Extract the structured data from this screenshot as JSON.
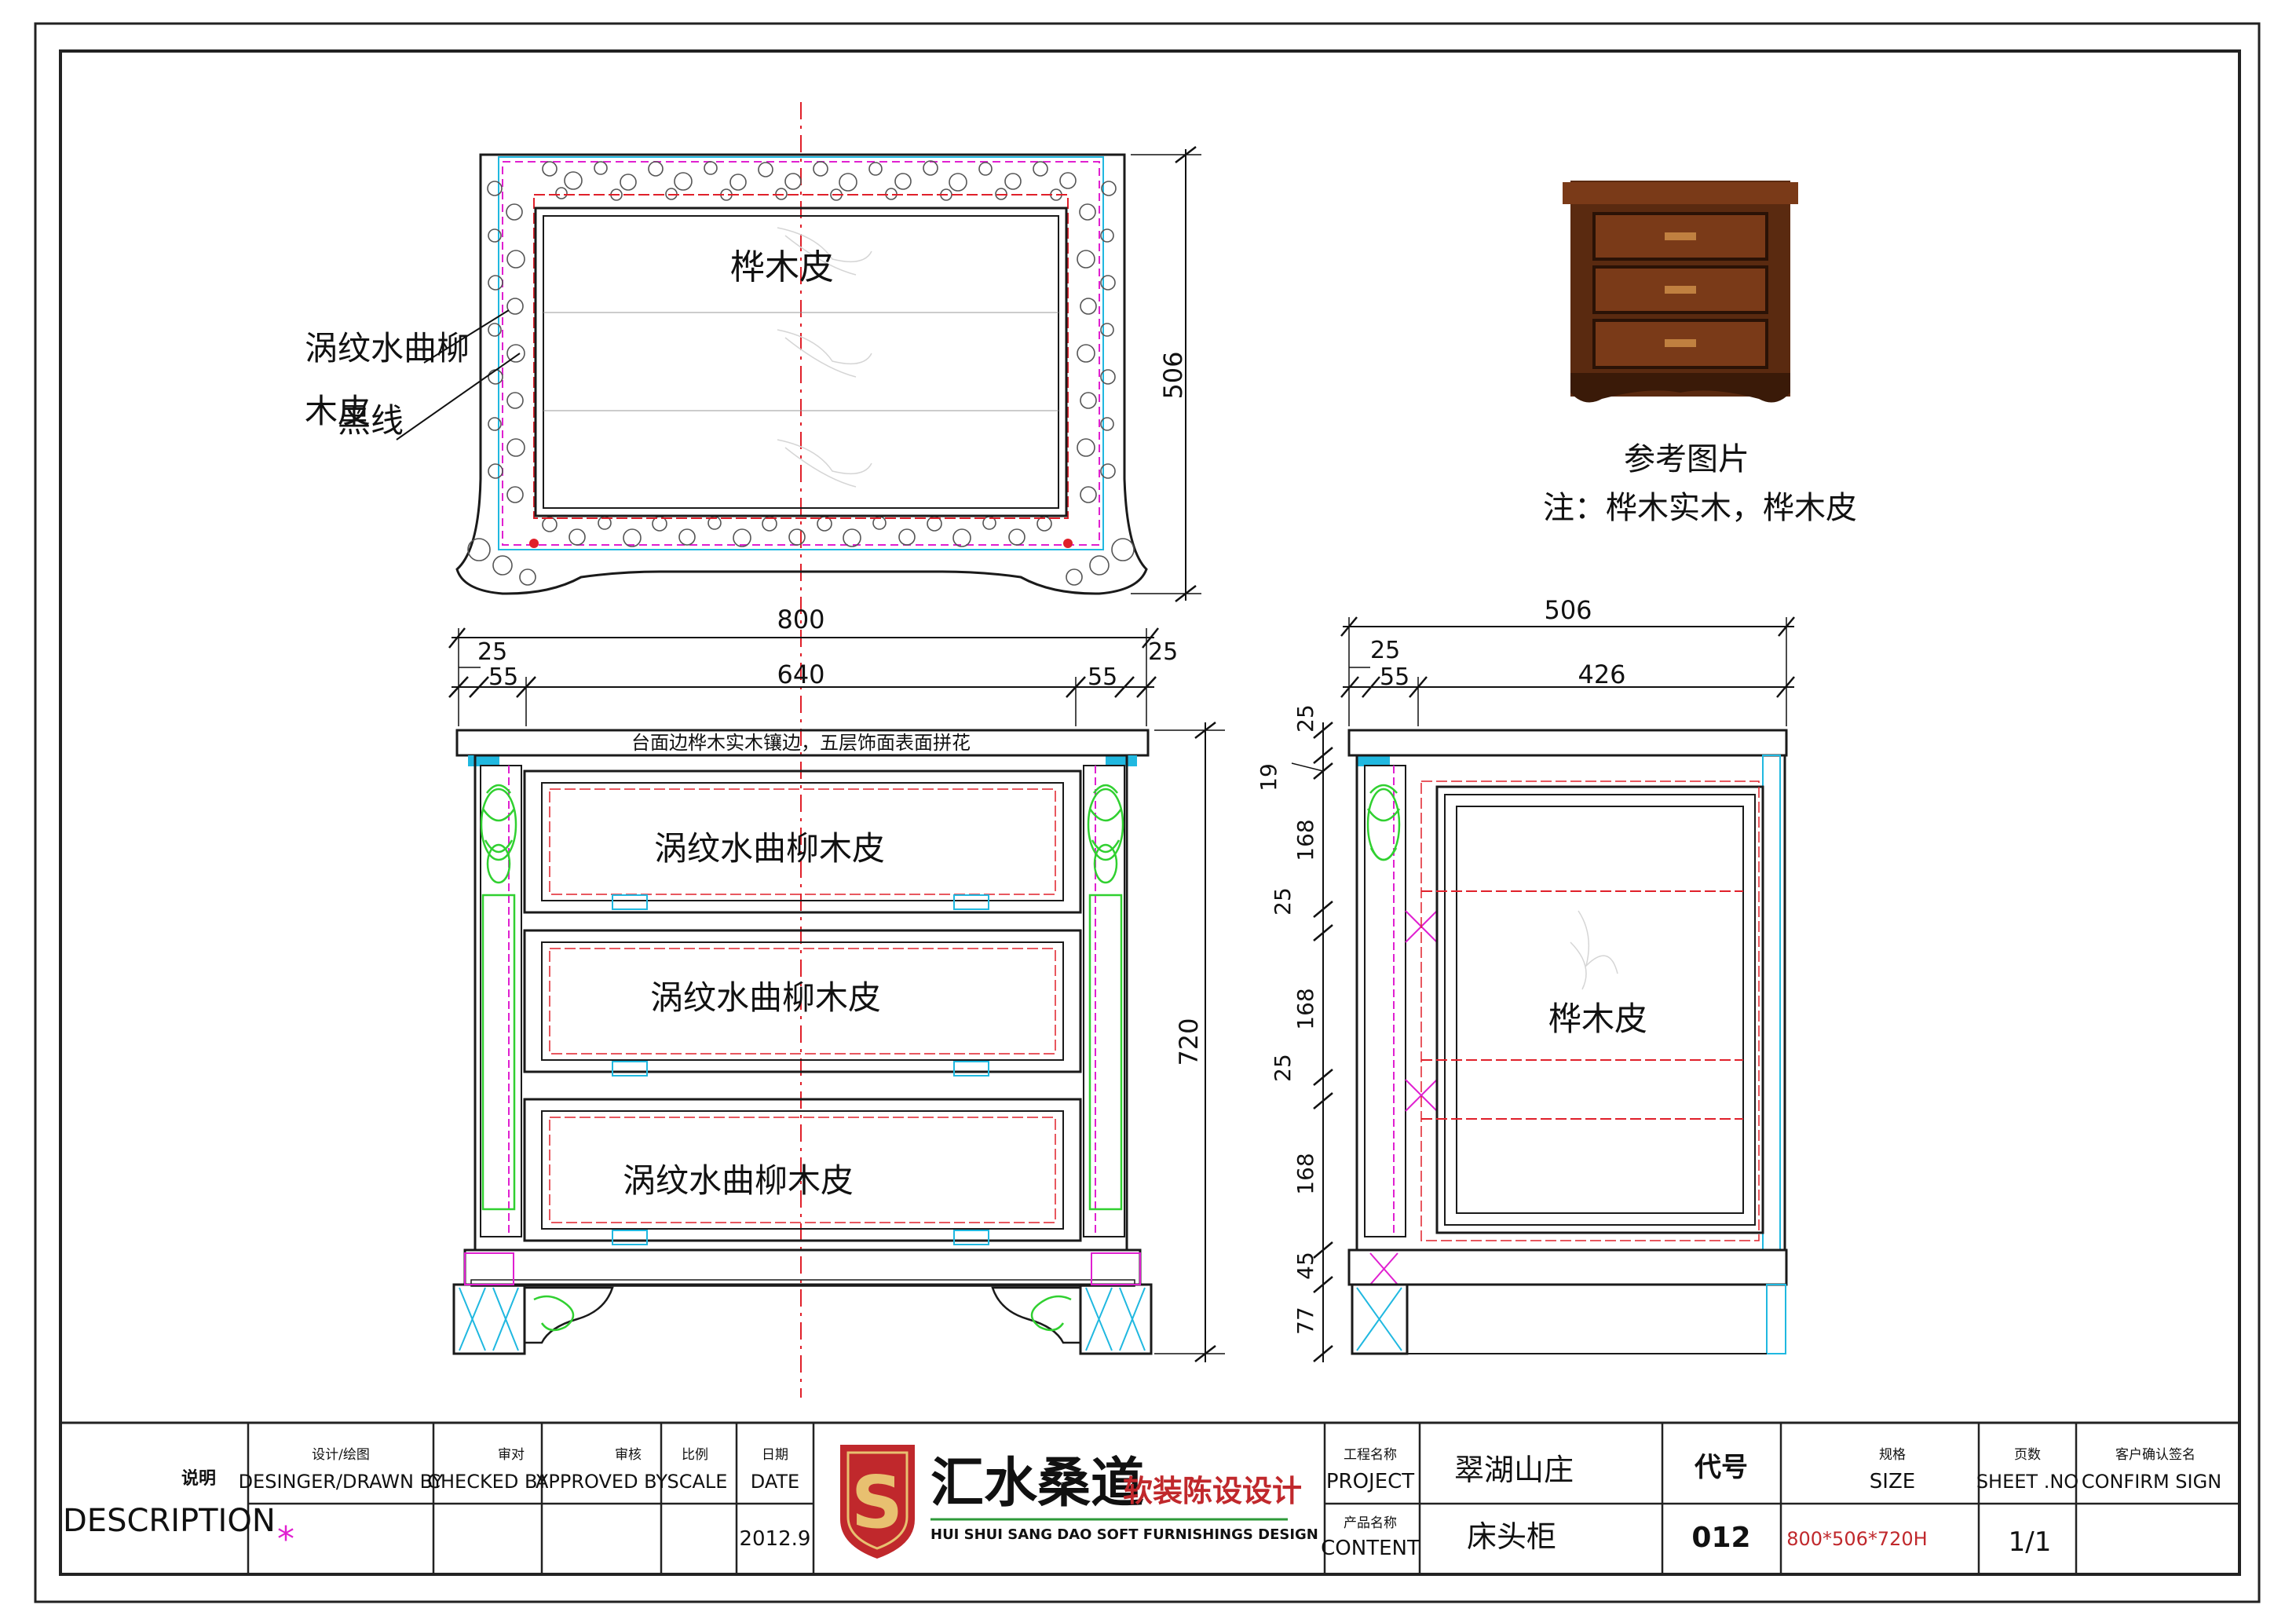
{
  "top_view": {
    "material_label": "桦木皮",
    "callout_line1": "涡纹水曲柳",
    "callout_line2": "木皮",
    "callout_line3": "黑线",
    "height_dim": "506",
    "width_dim": "800"
  },
  "reference": {
    "caption": "参考图片",
    "note": "注：桦木实木，桦木皮"
  },
  "front_view": {
    "dims": {
      "left_edge": "25",
      "right_edge": "25",
      "left_pilaster": "55",
      "right_pilaster": "55",
      "center": "640",
      "height": "720"
    },
    "top_note": "台面边桦木实木镶边，五层饰面表面拼花",
    "drawers": [
      {
        "label": "涡纹水曲柳木皮"
      },
      {
        "label": "涡纹水曲柳木皮"
      },
      {
        "label": "涡纹水曲柳木皮"
      }
    ]
  },
  "side_view": {
    "dims": {
      "total_width": "506",
      "left_edge": "25",
      "left_post": "55",
      "panel_width": "426",
      "v_25a": "25",
      "v_19": "19",
      "v_168a": "168",
      "v_25b": "25",
      "v_168b": "168",
      "v_25c": "25",
      "v_168c": "168",
      "v_45": "45",
      "v_77": "77"
    },
    "material_label": "桦木皮"
  },
  "title_block": {
    "desc_cn": "说明",
    "desc_en": "DESCRIPTION",
    "designer_cn": "设计/绘图",
    "designer_en": "DESINGER/DRAWN BY",
    "checked_cn": "审对",
    "checked_en": "CHECKED BY",
    "approved_cn": "审核",
    "approved_en": "APPROVED BY",
    "scale_cn": "比例",
    "scale_en": "SCALE",
    "date_cn": "日期",
    "date_en": "DATE",
    "date_value": "2012.9",
    "designer_value": "*",
    "company_cn": "汇水桑道",
    "company_tag": "软装陈设设计",
    "company_en": "HUI SHUI SANG DAO SOFT FURNISHINGS DESIGN",
    "logo_letter": "S",
    "project_cn": "工程名称",
    "project_en": "PROJECT",
    "project_value": "翠湖山庄",
    "content_cn": "产品名称",
    "content_en": "CONTENT",
    "content_value": "床头柜",
    "code_label": "代号",
    "code_value": "012",
    "size_cn": "规格",
    "size_en": "SIZE",
    "size_value": "800*506*720H",
    "sheet_cn": "页数",
    "sheet_en": "SHEET .NO",
    "sheet_value": "1/1",
    "confirm_cn": "客户确认签名",
    "confirm_en": "CONFIRM SIGN"
  },
  "colors": {
    "line": "#1a1a1a",
    "red": "#e0202a",
    "magenta": "#e020d0",
    "cyan": "#20b8e0",
    "green": "#30d030",
    "brand_red": "#c0282c",
    "brand_green": "#2e9a3a"
  }
}
